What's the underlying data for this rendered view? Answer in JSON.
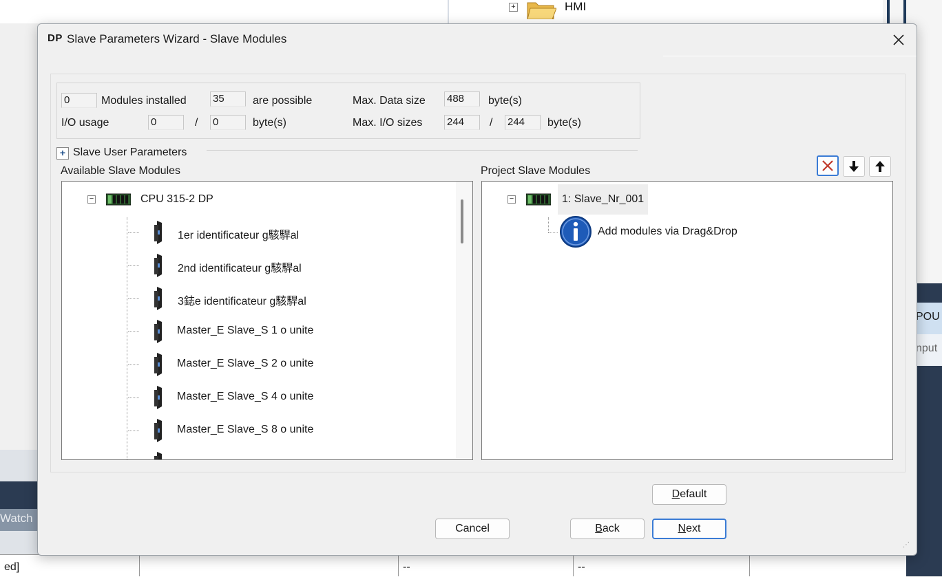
{
  "background": {
    "tree_node_label": "HMI",
    "right_tab_pou": "POU",
    "right_tab_input": "nput",
    "left_tab_watch": "Watch",
    "bottom_row": {
      "col1": "ed]",
      "col3": "--",
      "col4": "--"
    }
  },
  "dialog": {
    "title_icon": "DP",
    "title": "Slave Parameters Wizard - Slave Modules",
    "close_icon": "close-icon"
  },
  "info": {
    "modules_installed_value": "0",
    "modules_installed_label": "Modules installed",
    "possible_value": "35",
    "possible_label": "are possible",
    "max_data_size_label": "Max. Data size",
    "max_data_size_value": "488",
    "bytes_label": "byte(s)",
    "io_usage_label": "I/O usage",
    "io_usage_in": "0",
    "slash": "/",
    "io_usage_out": "0",
    "max_io_sizes_label": "Max. I/O sizes",
    "max_io_in": "244",
    "max_io_out": "244"
  },
  "user_parameters": {
    "expand_symbol": "+",
    "label": "Slave User Parameters"
  },
  "available": {
    "label": "Available Slave Modules",
    "root": "CPU 315-2 DP",
    "items": [
      "1er identificateur g駭駻al",
      "2nd identificateur g駭駻al",
      "3鋕e identificateur g駭駻al",
      "Master_E Slave_S  1 o unite",
      "Master_E Slave_S  2 o unite",
      "Master_E Slave_S  4 o unite",
      "Master_E Slave_S  8 o unite"
    ]
  },
  "project": {
    "label": "Project Slave Modules",
    "root": "1: Slave_Nr_001",
    "hint": "Add modules via Drag&Drop"
  },
  "toolbar": {
    "delete_icon": "delete-x-icon",
    "down_icon": "arrow-down-icon",
    "up_icon": "arrow-up-icon"
  },
  "buttons": {
    "default": {
      "accel": "D",
      "rest": "efault"
    },
    "cancel": "Cancel",
    "back": {
      "accel": "B",
      "rest": "ack"
    },
    "next": {
      "accel": "N",
      "rest": "ext"
    }
  },
  "colors": {
    "accent": "#3a7bd5",
    "info_icon": "#1e5bb8",
    "delete_red": "#c0392b"
  }
}
